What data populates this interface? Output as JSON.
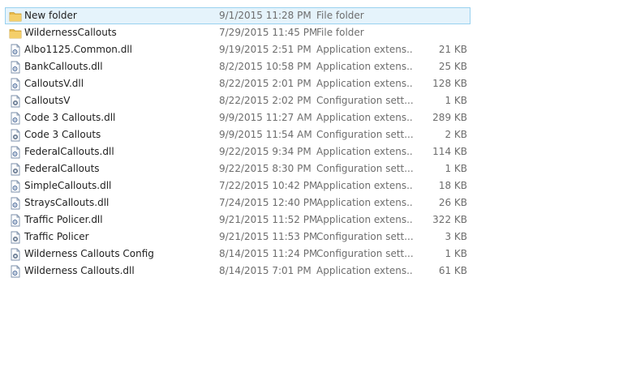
{
  "files": [
    {
      "name": "New folder",
      "date": "9/1/2015 11:28 PM",
      "type": "File folder",
      "size": "",
      "icon": "folder-icon",
      "selected": true
    },
    {
      "name": "WildernessCallouts",
      "date": "7/29/2015 11:45 PM",
      "type": "File folder",
      "size": "",
      "icon": "folder-icon",
      "selected": false
    },
    {
      "name": "Albo1125.Common.dll",
      "date": "9/19/2015 2:51 PM",
      "type": "Application extens...",
      "size": "21 KB",
      "icon": "dll-file-icon",
      "selected": false
    },
    {
      "name": "BankCallouts.dll",
      "date": "8/2/2015 10:58 PM",
      "type": "Application extens...",
      "size": "25 KB",
      "icon": "dll-file-icon",
      "selected": false
    },
    {
      "name": "CalloutsV.dll",
      "date": "8/22/2015 2:01 PM",
      "type": "Application extens...",
      "size": "128 KB",
      "icon": "dll-file-icon",
      "selected": false
    },
    {
      "name": "CalloutsV",
      "date": "8/22/2015 2:02 PM",
      "type": "Configuration sett...",
      "size": "1 KB",
      "icon": "config-file-icon",
      "selected": false
    },
    {
      "name": "Code 3 Callouts.dll",
      "date": "9/9/2015 11:27 AM",
      "type": "Application extens...",
      "size": "289 KB",
      "icon": "dll-file-icon",
      "selected": false
    },
    {
      "name": "Code 3 Callouts",
      "date": "9/9/2015 11:54 AM",
      "type": "Configuration sett...",
      "size": "2 KB",
      "icon": "config-file-icon",
      "selected": false
    },
    {
      "name": "FederalCallouts.dll",
      "date": "9/22/2015 9:34 PM",
      "type": "Application extens...",
      "size": "114 KB",
      "icon": "dll-file-icon",
      "selected": false
    },
    {
      "name": "FederalCallouts",
      "date": "9/22/2015 8:30 PM",
      "type": "Configuration sett...",
      "size": "1 KB",
      "icon": "config-file-icon",
      "selected": false
    },
    {
      "name": "SimpleCallouts.dll",
      "date": "7/22/2015 10:42 PM",
      "type": "Application extens...",
      "size": "18 KB",
      "icon": "dll-file-icon",
      "selected": false
    },
    {
      "name": "StraysCallouts.dll",
      "date": "7/24/2015 12:40 PM",
      "type": "Application extens...",
      "size": "26 KB",
      "icon": "dll-file-icon",
      "selected": false
    },
    {
      "name": "Traffic Policer.dll",
      "date": "9/21/2015 11:52 PM",
      "type": "Application extens...",
      "size": "322 KB",
      "icon": "dll-file-icon",
      "selected": false
    },
    {
      "name": "Traffic Policer",
      "date": "9/21/2015 11:53 PM",
      "type": "Configuration sett...",
      "size": "3 KB",
      "icon": "config-file-icon",
      "selected": false
    },
    {
      "name": "Wilderness Callouts Config",
      "date": "8/14/2015 11:24 PM",
      "type": "Configuration sett...",
      "size": "1 KB",
      "icon": "config-file-icon",
      "selected": false
    },
    {
      "name": "Wilderness Callouts.dll",
      "date": "8/14/2015 7:01 PM",
      "type": "Application extens...",
      "size": "61 KB",
      "icon": "dll-file-icon",
      "selected": false
    }
  ],
  "colors": {
    "selection_background": "#e5f3fb",
    "selection_border": "#99d1ef",
    "folder": "#e8b94a",
    "secondary_text": "#6d6d6d"
  }
}
